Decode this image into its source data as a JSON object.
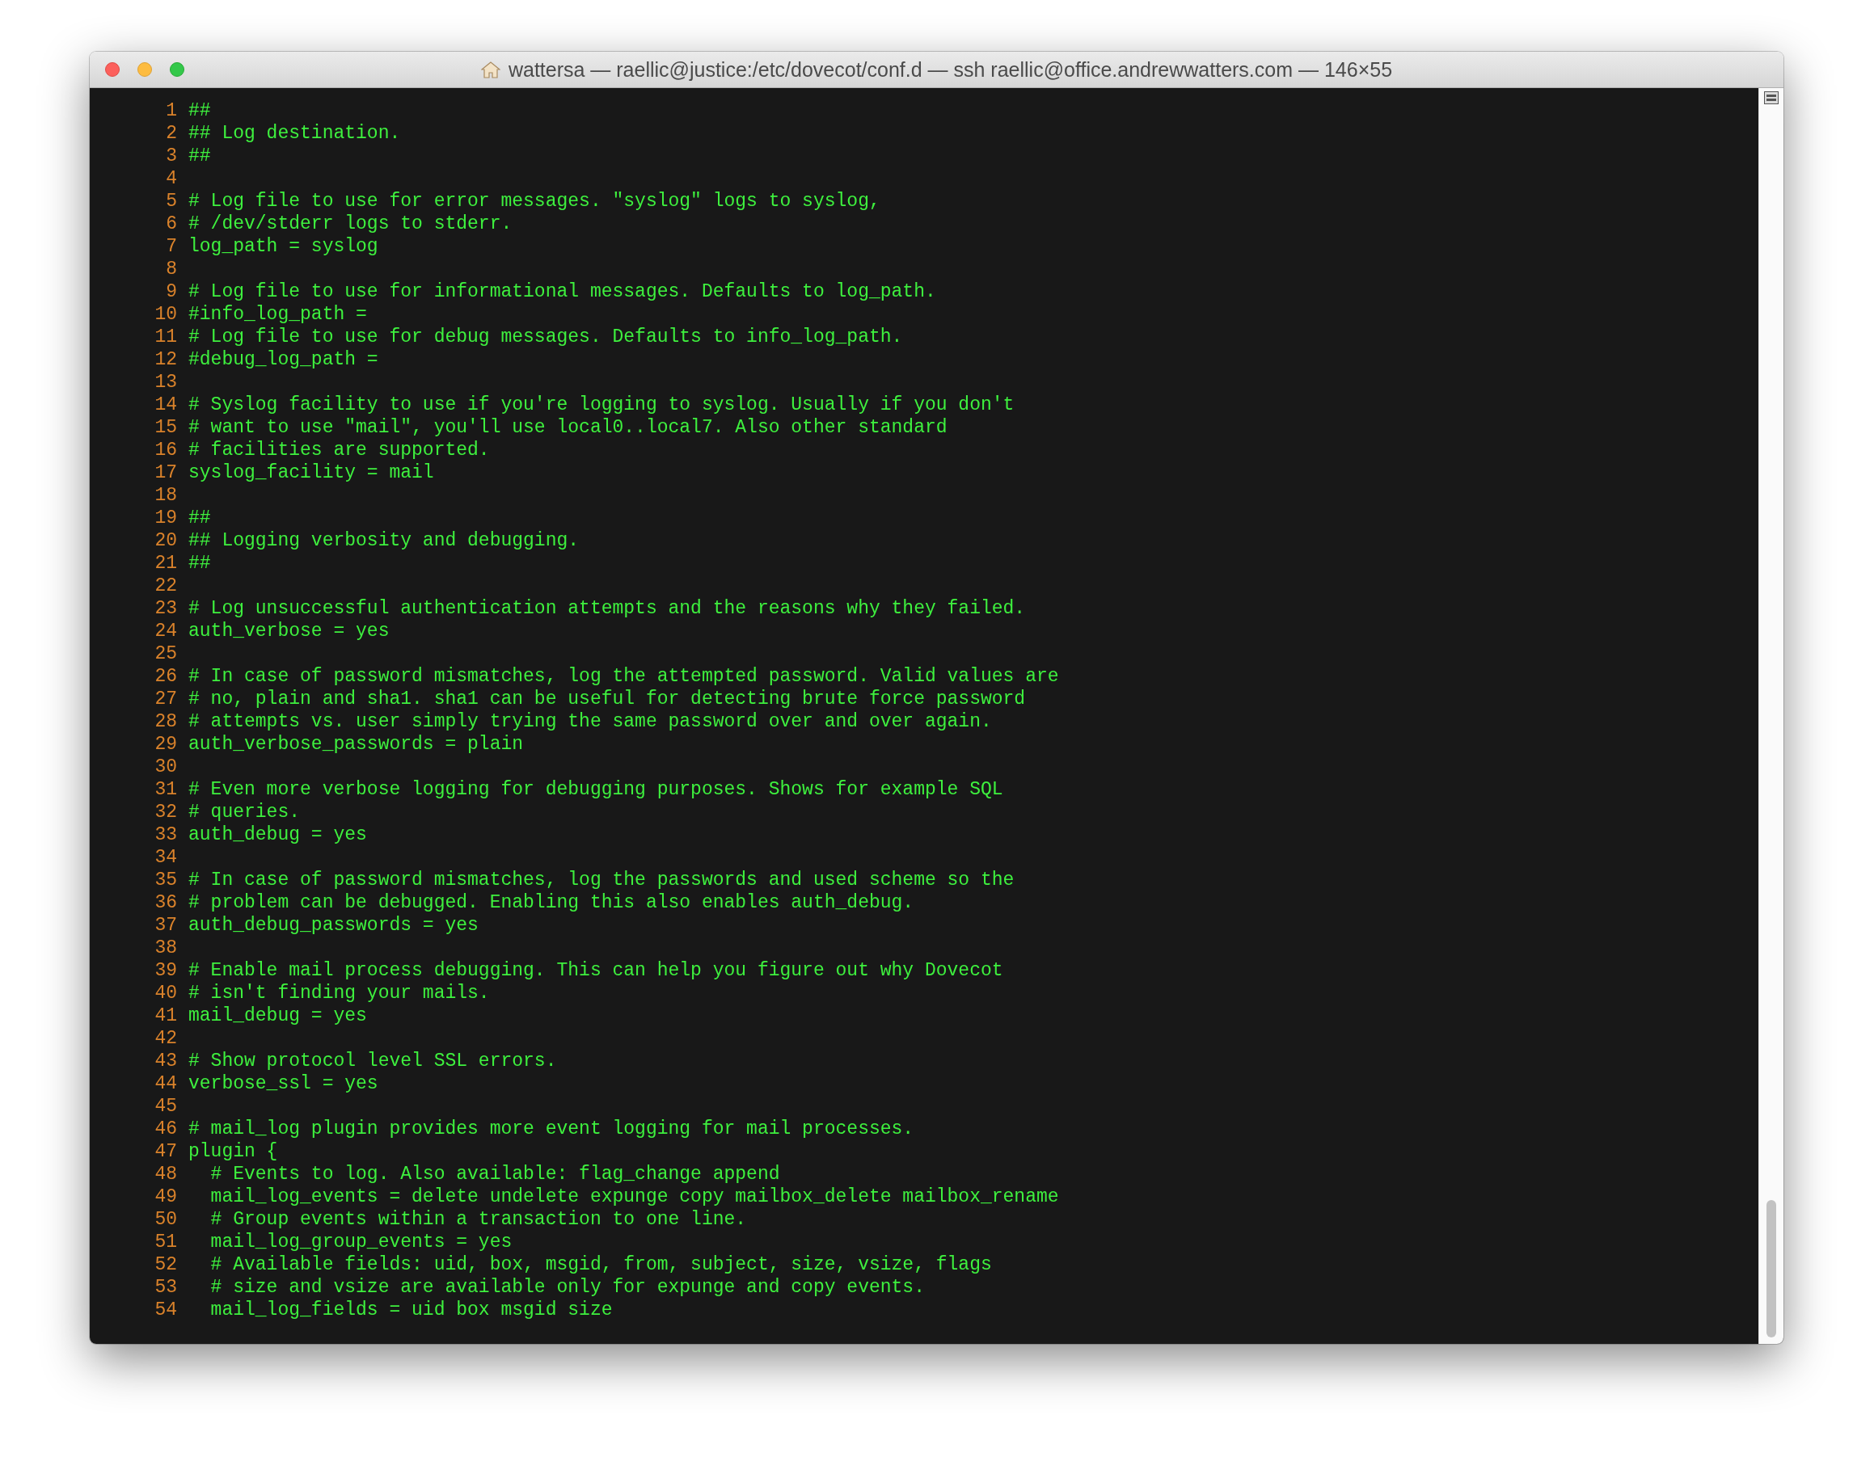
{
  "window": {
    "title": "wattersa — raellic@justice:/etc/dovecot/conf.d — ssh raellic@office.andrewwatters.com — 146×55"
  },
  "lines": [
    {
      "number": "1",
      "text": "##"
    },
    {
      "number": "2",
      "text": "## Log destination."
    },
    {
      "number": "3",
      "text": "##"
    },
    {
      "number": "4"
    },
    {
      "number": "5",
      "text": "# Log file to use for error messages. \"syslog\" logs to syslog,"
    },
    {
      "number": "6",
      "text": "# /dev/stderr logs to stderr."
    },
    {
      "number": "7",
      "text": "log_path = syslog"
    },
    {
      "number": "8"
    },
    {
      "number": "9",
      "text": "# Log file to use for informational messages. Defaults to log_path."
    },
    {
      "number": "10",
      "text": "#info_log_path ="
    },
    {
      "number": "11",
      "text": "# Log file to use for debug messages. Defaults to info_log_path."
    },
    {
      "number": "12",
      "text": "#debug_log_path ="
    },
    {
      "number": "13"
    },
    {
      "number": "14",
      "text": "# Syslog facility to use if you're logging to syslog. Usually if you don't"
    },
    {
      "number": "15",
      "text": "# want to use \"mail\", you'll use local0..local7. Also other standard"
    },
    {
      "number": "16",
      "text": "# facilities are supported."
    },
    {
      "number": "17",
      "text": "syslog_facility = mail"
    },
    {
      "number": "18"
    },
    {
      "number": "19",
      "text": "##"
    },
    {
      "number": "20",
      "text": "## Logging verbosity and debugging."
    },
    {
      "number": "21",
      "text": "##"
    },
    {
      "number": "22"
    },
    {
      "number": "23",
      "text": "# Log unsuccessful authentication attempts and the reasons why they failed."
    },
    {
      "number": "24",
      "text": "auth_verbose = yes"
    },
    {
      "number": "25"
    },
    {
      "number": "26",
      "text": "# In case of password mismatches, log the attempted password. Valid values are"
    },
    {
      "number": "27",
      "text": "# no, plain and sha1. sha1 can be useful for detecting brute force password"
    },
    {
      "number": "28",
      "text": "# attempts vs. user simply trying the same password over and over again."
    },
    {
      "number": "29",
      "text": "auth_verbose_passwords = plain"
    },
    {
      "number": "30"
    },
    {
      "number": "31",
      "text": "# Even more verbose logging for debugging purposes. Shows for example SQL"
    },
    {
      "number": "32",
      "text": "# queries."
    },
    {
      "number": "33",
      "text": "auth_debug = yes"
    },
    {
      "number": "34"
    },
    {
      "number": "35",
      "text": "# In case of password mismatches, log the passwords and used scheme so the"
    },
    {
      "number": "36",
      "text": "# problem can be debugged. Enabling this also enables auth_debug."
    },
    {
      "number": "37",
      "text": "auth_debug_passwords = yes"
    },
    {
      "number": "38"
    },
    {
      "number": "39",
      "text": "# Enable mail process debugging. This can help you figure out why Dovecot"
    },
    {
      "number": "40",
      "text": "# isn't finding your mails."
    },
    {
      "number": "41",
      "text": "mail_debug = yes"
    },
    {
      "number": "42"
    },
    {
      "number": "43",
      "text": "# Show protocol level SSL errors."
    },
    {
      "number": "44",
      "text": "verbose_ssl = yes"
    },
    {
      "number": "45"
    },
    {
      "number": "46",
      "text": "# mail_log plugin provides more event logging for mail processes."
    },
    {
      "number": "47",
      "text": "plugin {"
    },
    {
      "number": "48",
      "text": "  # Events to log. Also available: flag_change append"
    },
    {
      "number": "49",
      "text": "  mail_log_events = delete undelete expunge copy mailbox_delete mailbox_rename"
    },
    {
      "number": "50",
      "text": "  # Group events within a transaction to one line."
    },
    {
      "number": "51",
      "text": "  mail_log_group_events = yes"
    },
    {
      "number": "52",
      "text": "  # Available fields: uid, box, msgid, from, subject, size, vsize, flags"
    },
    {
      "number": "53",
      "text": "  # size and vsize are available only for expunge and copy events."
    },
    {
      "number": "54",
      "text": "  mail_log_fields = uid box msgid size"
    }
  ]
}
